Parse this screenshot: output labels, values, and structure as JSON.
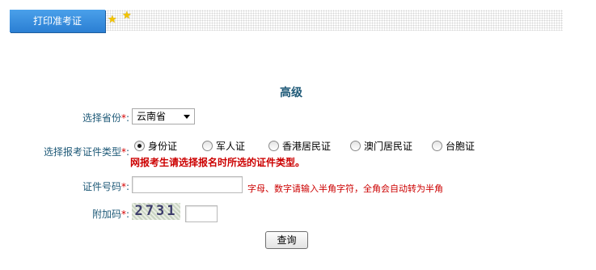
{
  "tabbar": {
    "active_tab_label": "打印准考证"
  },
  "form": {
    "title": "高级",
    "required_mark": "*",
    "province": {
      "label": "选择省份",
      "selected": "云南省"
    },
    "id_type": {
      "label": "选择报考证件类型",
      "options": [
        {
          "label": "身份证",
          "checked": true
        },
        {
          "label": "军人证",
          "checked": false
        },
        {
          "label": "香港居民证",
          "checked": false
        },
        {
          "label": "澳门居民证",
          "checked": false
        },
        {
          "label": "台胞证",
          "checked": false
        }
      ],
      "warning": "网报考生请选择报名时所选的证件类型。"
    },
    "id_number": {
      "label": "证件号码",
      "value": "",
      "hint": "字母、数字请输入半角字符，全角会自动转为半角"
    },
    "captcha": {
      "label": "附加码",
      "image_text": "2731",
      "value": ""
    },
    "submit_label": "查询"
  }
}
